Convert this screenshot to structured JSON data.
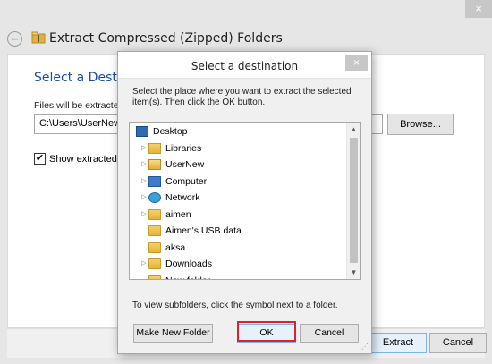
{
  "window": {
    "title": "Extract Compressed (Zipped) Folders",
    "close_glyph": "×",
    "back_glyph": "←"
  },
  "wizard": {
    "heading": "Select a Destin",
    "files_label": "Files will be extracte",
    "path_value": "C:\\Users\\UserNew",
    "browse_label": "Browse...",
    "show_checked": true,
    "show_label": "Show extracted f",
    "extract_label": "Extract",
    "cancel_label": "Cancel"
  },
  "dialog": {
    "title": "Select a destination",
    "close_glyph": "×",
    "instructions": "Select the place where you want to extract the selected item(s).  Then click the OK button.",
    "tree": [
      {
        "label": "Desktop",
        "icon": "desktop-icon",
        "expander": ""
      },
      {
        "label": "Libraries",
        "icon": "libraries-icon",
        "expander": "▷"
      },
      {
        "label": "UserNew",
        "icon": "user-folder-icon",
        "expander": "▷"
      },
      {
        "label": "Computer",
        "icon": "computer-icon",
        "expander": "▷"
      },
      {
        "label": "Network",
        "icon": "network-icon",
        "expander": "▷"
      },
      {
        "label": "aimen",
        "icon": "folder-icon",
        "expander": "▷"
      },
      {
        "label": "Aimen's USB data",
        "icon": "folder-icon",
        "expander": ""
      },
      {
        "label": "aksa",
        "icon": "folder-icon",
        "expander": ""
      },
      {
        "label": "Downloads",
        "icon": "folder-icon",
        "expander": "▷"
      },
      {
        "label": "New folder",
        "icon": "folder-icon",
        "expander": ""
      }
    ],
    "hint": "To view subfolders, click the symbol next to a folder.",
    "new_folder_label": "Make New Folder",
    "ok_label": "OK",
    "cancel_label": "Cancel"
  },
  "colors": {
    "heading_blue": "#1a4e9c",
    "highlight_red": "#e0202a"
  }
}
